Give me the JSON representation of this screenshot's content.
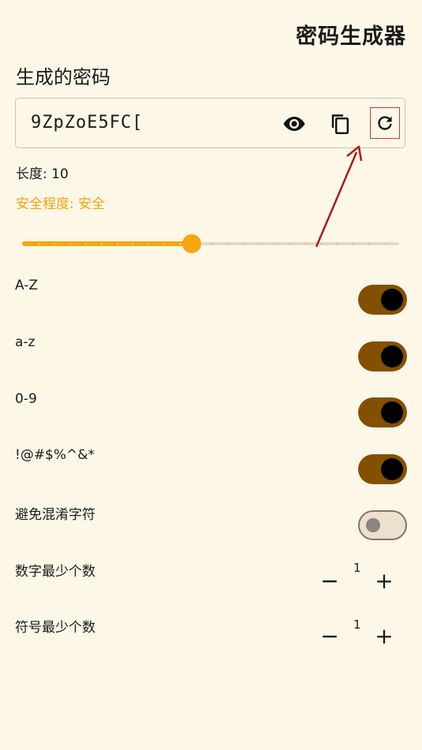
{
  "header": {
    "title": "密码生成器"
  },
  "password_section": {
    "title": "生成的密码",
    "value": "9ZpZoE5FC[",
    "icons": {
      "show": "eye-icon",
      "copy": "copy-icon",
      "regenerate": "refresh-icon"
    }
  },
  "length": {
    "label": "长度: 10",
    "value": 10
  },
  "safety": {
    "label": "安全程度: 安全",
    "color": "#f2a30f"
  },
  "slider": {
    "level_fraction": 0.45,
    "accent": "#f7a50f"
  },
  "options": [
    {
      "label": "A-Z",
      "on": true
    },
    {
      "label": "a-z",
      "on": true
    },
    {
      "label": "0-9",
      "on": true
    },
    {
      "label": "!@#$%^&*",
      "on": true
    },
    {
      "label": "避免混淆字符",
      "on": false
    }
  ],
  "min_digits": {
    "label": "数字最少个数",
    "value": "1",
    "minus": "−",
    "plus": "+"
  },
  "min_symbols": {
    "label": "符号最少个数",
    "value": "1",
    "minus": "−",
    "plus": "+"
  },
  "colors": {
    "background": "#fdf7e8",
    "toggle_on": "#835000",
    "annotation": "#a51c1c"
  }
}
